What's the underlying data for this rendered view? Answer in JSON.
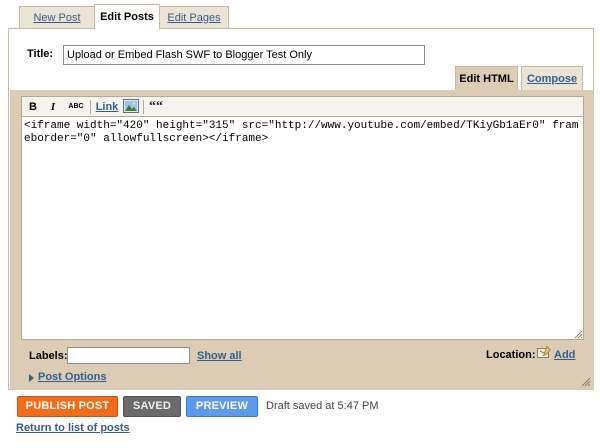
{
  "tabs": {
    "new_post": "New Post",
    "edit_posts": "Edit Posts",
    "edit_pages": "Edit Pages"
  },
  "post": {
    "title_label": "Title:",
    "title_value": "Upload or Embed Flash SWF to Blogger Test Only",
    "body": "<iframe width=\"420\" height=\"315\" src=\"http://www.youtube.com/embed/TKiyGb1aEr0\" frameborder=\"0\" allowfullscreen></iframe>"
  },
  "mode_tabs": {
    "edit_html": "Edit HTML",
    "compose": "Compose"
  },
  "toolbar": {
    "bold": "B",
    "italic": "I",
    "spellcheck": "ABC",
    "link": "Link",
    "image_icon": "image-icon",
    "quote": "““"
  },
  "labels": {
    "label": "Labels:",
    "value": "",
    "show_all": "Show all"
  },
  "location": {
    "label": "Location:",
    "add": "Add"
  },
  "post_options": "Post Options",
  "actions": {
    "publish": "PUBLISH POST",
    "saved": "SAVED",
    "preview": "PREVIEW",
    "draft_status": "Draft saved at 5:47 PM"
  },
  "return_link": "Return to list of posts",
  "colors": {
    "publish": "#f26c19",
    "saved": "#6b6b6b",
    "preview": "#5b9bea",
    "panel_bg": "#dcccb6",
    "link": "#335e8c"
  }
}
